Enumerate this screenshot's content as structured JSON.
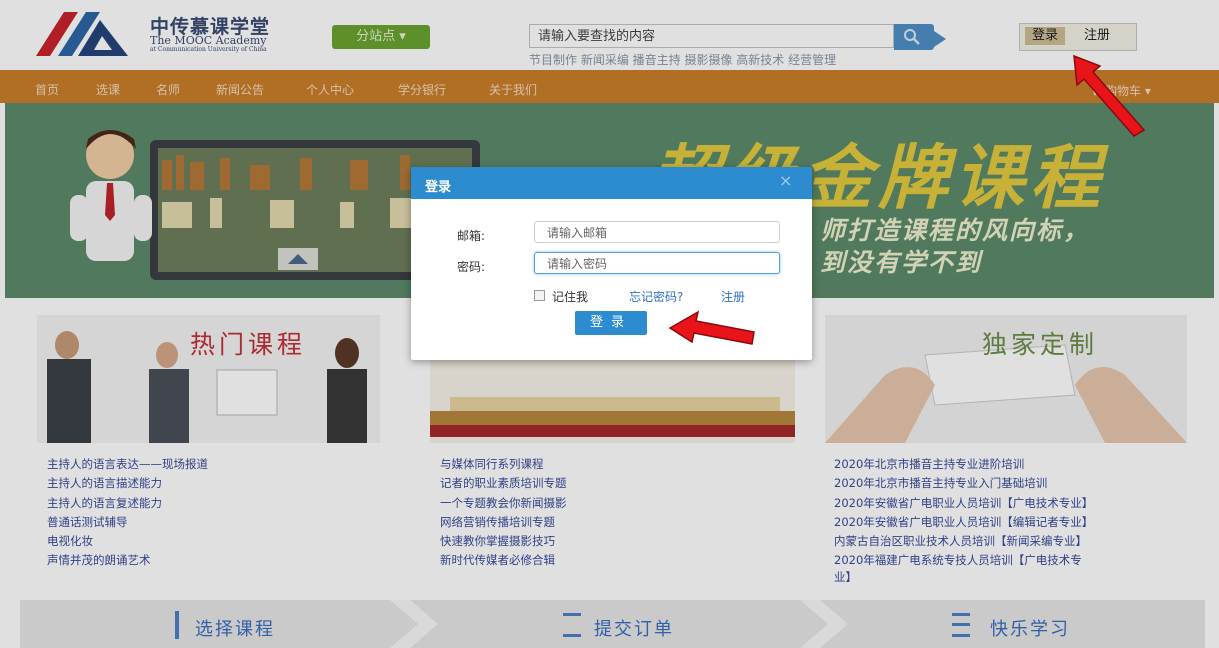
{
  "header": {
    "logo_cn": "中传慕课学堂",
    "logo_en": "The MOOC Academy",
    "logo_en_small": "at Communication University of China",
    "branch_label": "分站点 ▾",
    "search_placeholder": "请输入要查找的内容",
    "hot_tags": "节目制作 新闻采编 播音主持 摄影摄像 高新技术 经营管理",
    "login_label": "登录",
    "register_label": "注册"
  },
  "nav": {
    "items": [
      "首页",
      "选课",
      "名师",
      "新闻公告",
      "个人中心",
      "学分银行",
      "关于我们"
    ],
    "cart_label": "购物车 ▾"
  },
  "banner": {
    "title": "超级金牌课程",
    "subtitle_line1": "师打造课程的风向标，",
    "subtitle_line2": "到没有学不到"
  },
  "sections": {
    "hot": {
      "title": "热门课程",
      "items": [
        "主持人的语言表达——现场报道",
        "主持人的语言描述能力",
        "主持人的语言复述能力",
        "普通话测试辅导",
        "电视化妆",
        "声情并茂的朗诵艺术"
      ]
    },
    "middle": {
      "items": [
        "与媒体同行系列课程",
        "记者的职业素质培训专题",
        "一个专题教会你新闻摄影",
        "网络营销传播培训专题",
        "快速教你掌握摄影技巧",
        "新时代传媒者必修合辑"
      ]
    },
    "custom": {
      "title": "独家定制",
      "items": [
        "2020年北京市播音主持专业进阶培训",
        "2020年北京市播音主持专业入门基础培训",
        "2020年安徽省广电职业人员培训【广电技术专业】",
        "2020年安徽省广电职业人员培训【编辑记者专业】",
        "内蒙古自治区职业技术人员培训【新闻采编专业】",
        "2020年福建广电系统专技人员培训【广电技术专",
        "业】"
      ]
    }
  },
  "steps": [
    "选择课程",
    "提交订单",
    "快乐学习"
  ],
  "modal": {
    "title": "登录",
    "close": "×",
    "email_label": "邮箱:",
    "email_placeholder": "请输入邮箱",
    "password_label": "密码:",
    "password_placeholder": "请输入密码",
    "remember_label": "记住我",
    "forgot_label": "忘记密码?",
    "register_label": "注册",
    "submit_label": "登录"
  },
  "colors": {
    "nav_bg": "#ca7e2b",
    "modal_header": "#2d8ccf",
    "arrow": "#e8141a",
    "banner_bg": "#5c8a6a",
    "link": "#3b4b9a"
  }
}
